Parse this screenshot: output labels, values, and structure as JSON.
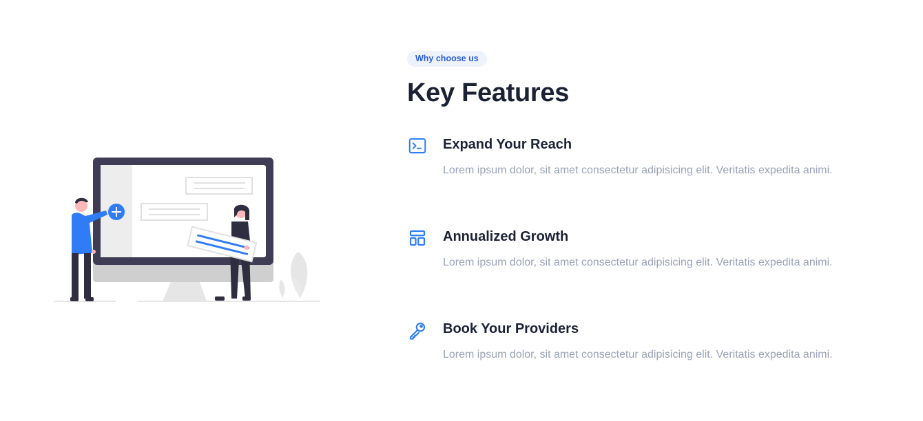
{
  "section": {
    "eyebrow": "Why choose us",
    "title": "Key Features"
  },
  "features": [
    {
      "icon": "terminal-icon",
      "title": "Expand Your Reach",
      "text": "Lorem ipsum dolor, sit amet consectetur adipisicing elit. Veritatis expedita animi."
    },
    {
      "icon": "layout-icon",
      "title": "Annualized Growth",
      "text": "Lorem ipsum dolor, sit amet consectetur adipisicing elit. Veritatis expedita animi."
    },
    {
      "icon": "key-icon",
      "title": "Book Your Providers",
      "text": "Lorem ipsum dolor, sit amet consectetur adipisicing elit. Veritatis expedita animi."
    }
  ],
  "colors": {
    "accent": "#2f7cf6",
    "heading": "#1b2234",
    "body_text": "#9aa2b6",
    "eyebrow_bg": "#eef2fb",
    "monitor": "#3f3d56"
  }
}
